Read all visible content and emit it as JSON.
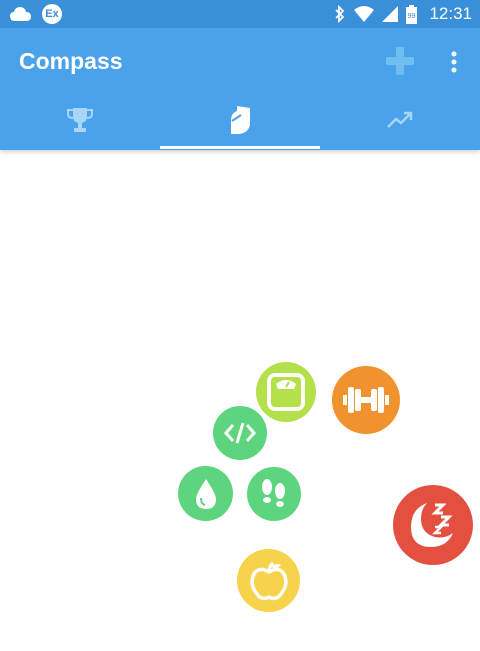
{
  "status_bar": {
    "notification_badge": "Ex",
    "time": "12:31",
    "battery_level": "99",
    "icons": [
      "cloud-icon",
      "bluetooth-icon",
      "wifi-icon",
      "signal-icon",
      "battery-icon"
    ]
  },
  "app_bar": {
    "title": "Compass",
    "actions": [
      "add-icon",
      "more-vert-icon"
    ],
    "color": "#4aa3ea",
    "status_color": "#3a8fd9"
  },
  "tabs": [
    {
      "icon": "trophy-icon",
      "selected": false
    },
    {
      "icon": "shield-icon",
      "selected": true
    },
    {
      "icon": "trending-up-icon",
      "selected": false
    }
  ],
  "goal_bubbles": [
    {
      "name": "weight-scale",
      "icon": "scale-icon",
      "color": "#b4e04a"
    },
    {
      "name": "fitness",
      "icon": "dumbbell-icon",
      "color": "#f0922e"
    },
    {
      "name": "coding",
      "icon": "code-icon",
      "color": "#5dd57e"
    },
    {
      "name": "hydration",
      "icon": "water-drop-icon",
      "color": "#5dd57e"
    },
    {
      "name": "walking",
      "icon": "footsteps-icon",
      "color": "#5dd57e"
    },
    {
      "name": "sleep",
      "icon": "sleep-icon",
      "color": "#e4503f"
    },
    {
      "name": "nutrition",
      "icon": "apple-icon",
      "color": "#f6d34a"
    }
  ]
}
